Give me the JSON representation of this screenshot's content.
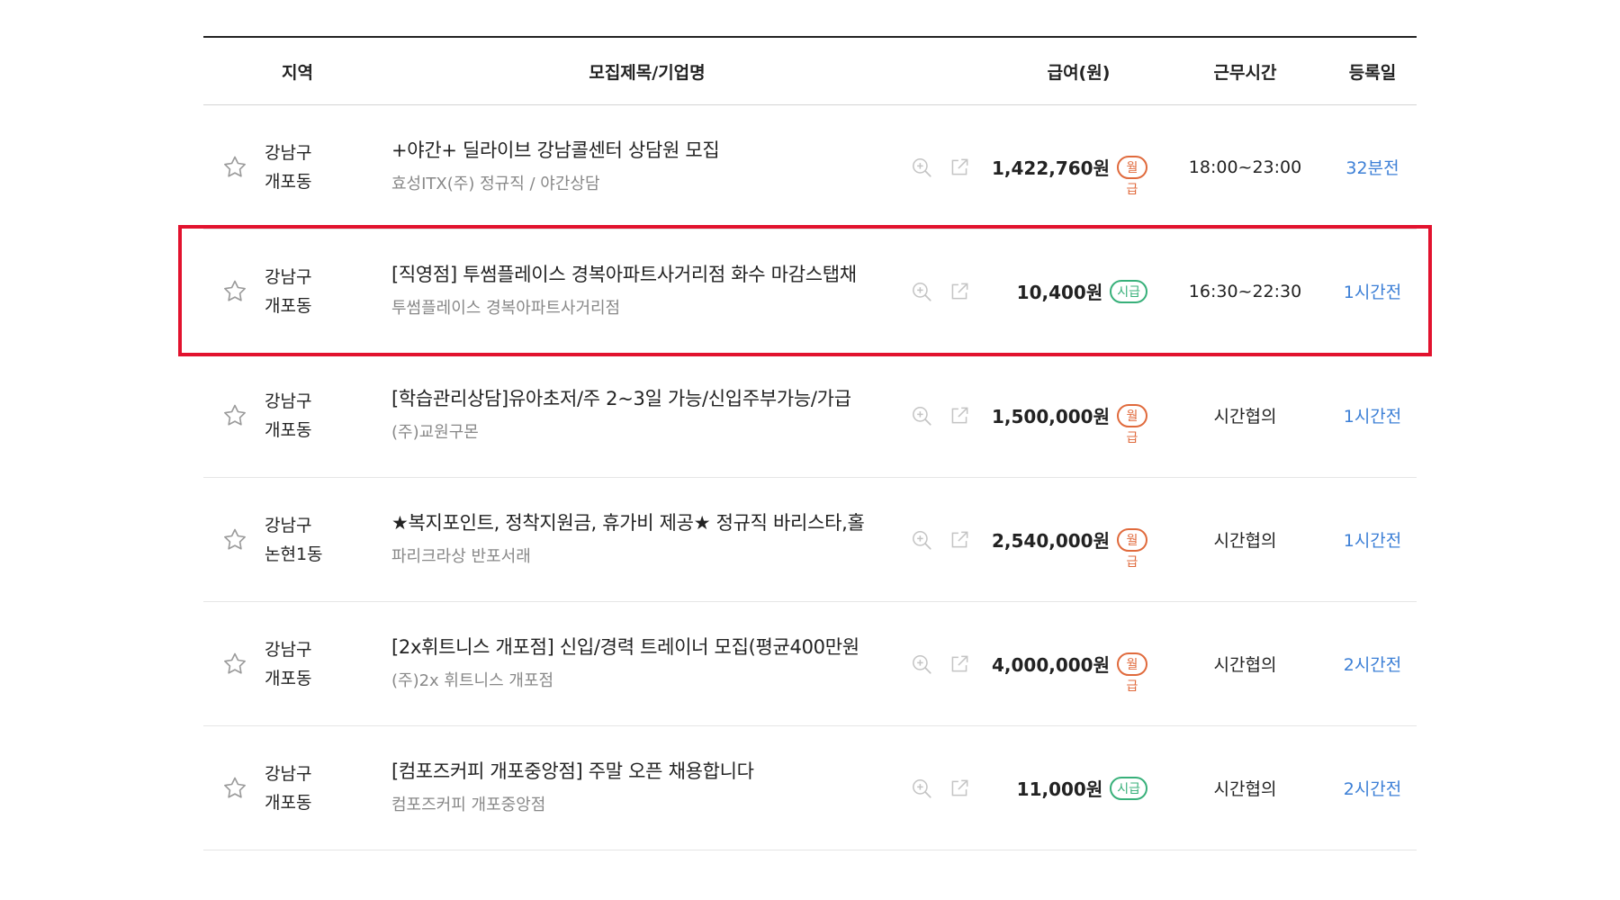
{
  "headers": {
    "region": "지역",
    "title": "모집제목/기업명",
    "pay": "급여(원)",
    "hours": "근무시간",
    "date": "등록일"
  },
  "colors": {
    "highlight": "#e2122e",
    "monthly_badge": "#e06a3c",
    "hourly_badge": "#38b07a",
    "date_link": "#3c7fd6"
  },
  "icons": {
    "favorite": "star-outline-icon",
    "preview": "zoom-in-icon",
    "open_new": "external-link-icon"
  },
  "highlighted_row": 1,
  "rows": [
    {
      "region_gu": "강남구",
      "region_dong": "개포동",
      "title": "+야간+ 딜라이브 강남콜센터 상담원 모집",
      "company": "효성ITX(주) 정규직 / 야간상담",
      "pay": "1,422,760원",
      "pay_type": "월급",
      "hours": "18:00~23:00",
      "date": "32분전"
    },
    {
      "region_gu": "강남구",
      "region_dong": "개포동",
      "title": "[직영점] 투썸플레이스 경복아파트사거리점 화수 마감스탭채",
      "company": "투썸플레이스 경복아파트사거리점",
      "pay": "10,400원",
      "pay_type": "시급",
      "hours": "16:30~22:30",
      "date": "1시간전"
    },
    {
      "region_gu": "강남구",
      "region_dong": "개포동",
      "title": "[학습관리상담]유아초저/주 2~3일 가능/신입주부가능/가급",
      "company": "(주)교원구몬",
      "pay": "1,500,000원",
      "pay_type": "월급",
      "hours": "시간협의",
      "date": "1시간전"
    },
    {
      "region_gu": "강남구",
      "region_dong": "논현1동",
      "title": "★복지포인트, 정착지원금, 휴가비 제공★ 정규직 바리스타,홀",
      "company": "파리크라상 반포서래",
      "pay": "2,540,000원",
      "pay_type": "월급",
      "hours": "시간협의",
      "date": "1시간전"
    },
    {
      "region_gu": "강남구",
      "region_dong": "개포동",
      "title": "[2x휘트니스 개포점] 신입/경력 트레이너 모집(평균400만원",
      "company": "(주)2x 휘트니스 개포점",
      "pay": "4,000,000원",
      "pay_type": "월급",
      "hours": "시간협의",
      "date": "2시간전"
    },
    {
      "region_gu": "강남구",
      "region_dong": "개포동",
      "title": "[컴포즈커피 개포중앙점] 주말 오픈 채용합니다",
      "company": "컴포즈커피 개포중앙점",
      "pay": "11,000원",
      "pay_type": "시급",
      "hours": "시간협의",
      "date": "2시간전"
    }
  ]
}
